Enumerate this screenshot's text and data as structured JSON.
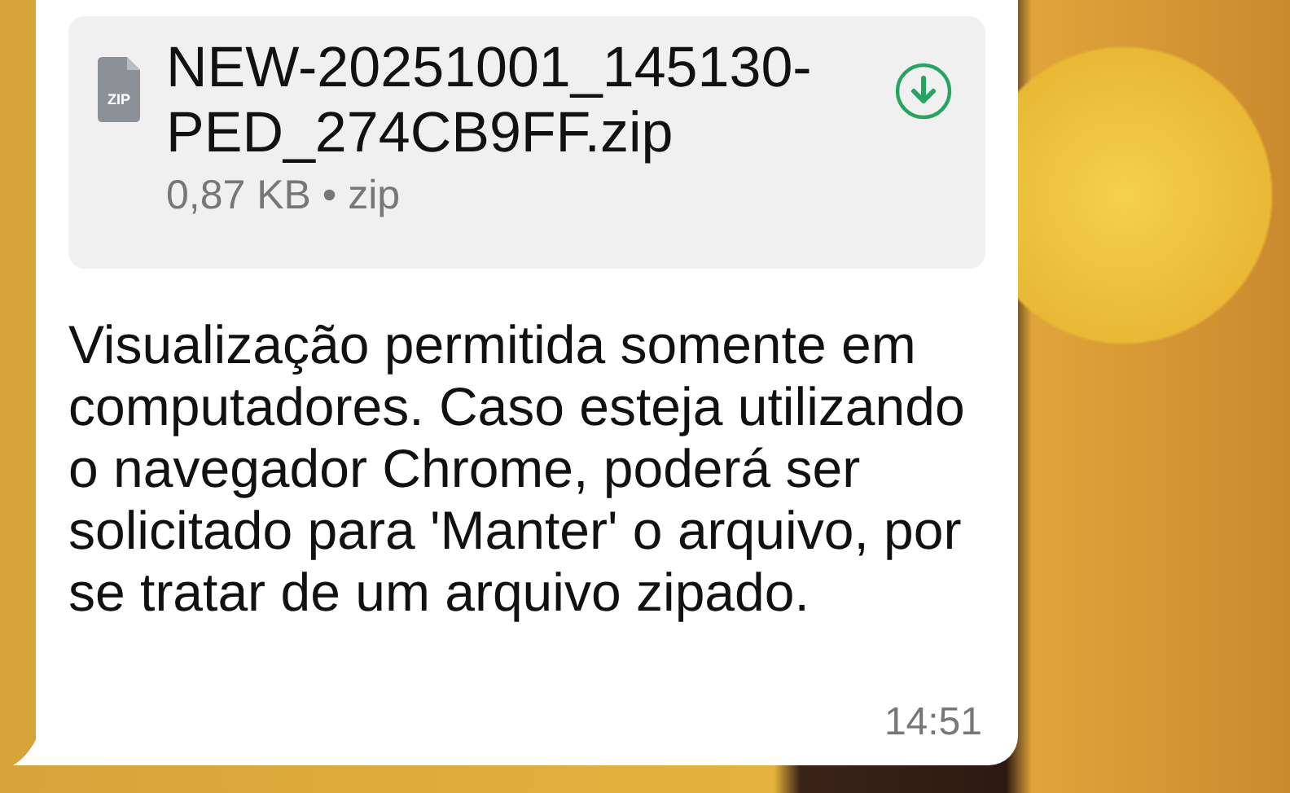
{
  "attachment": {
    "icon_label": "ZIP",
    "file_name": "NEW-20251001_145130-PED_274CB9FF.zip",
    "meta": "0,87 KB • zip"
  },
  "message": {
    "text": "Visualização permitida somente em computadores. Caso esteja utilizando o navegador Chrome, poderá ser solicitado para 'Manter' o arquivo, por se tratar de um arquivo zipado.",
    "time": "14:51"
  }
}
